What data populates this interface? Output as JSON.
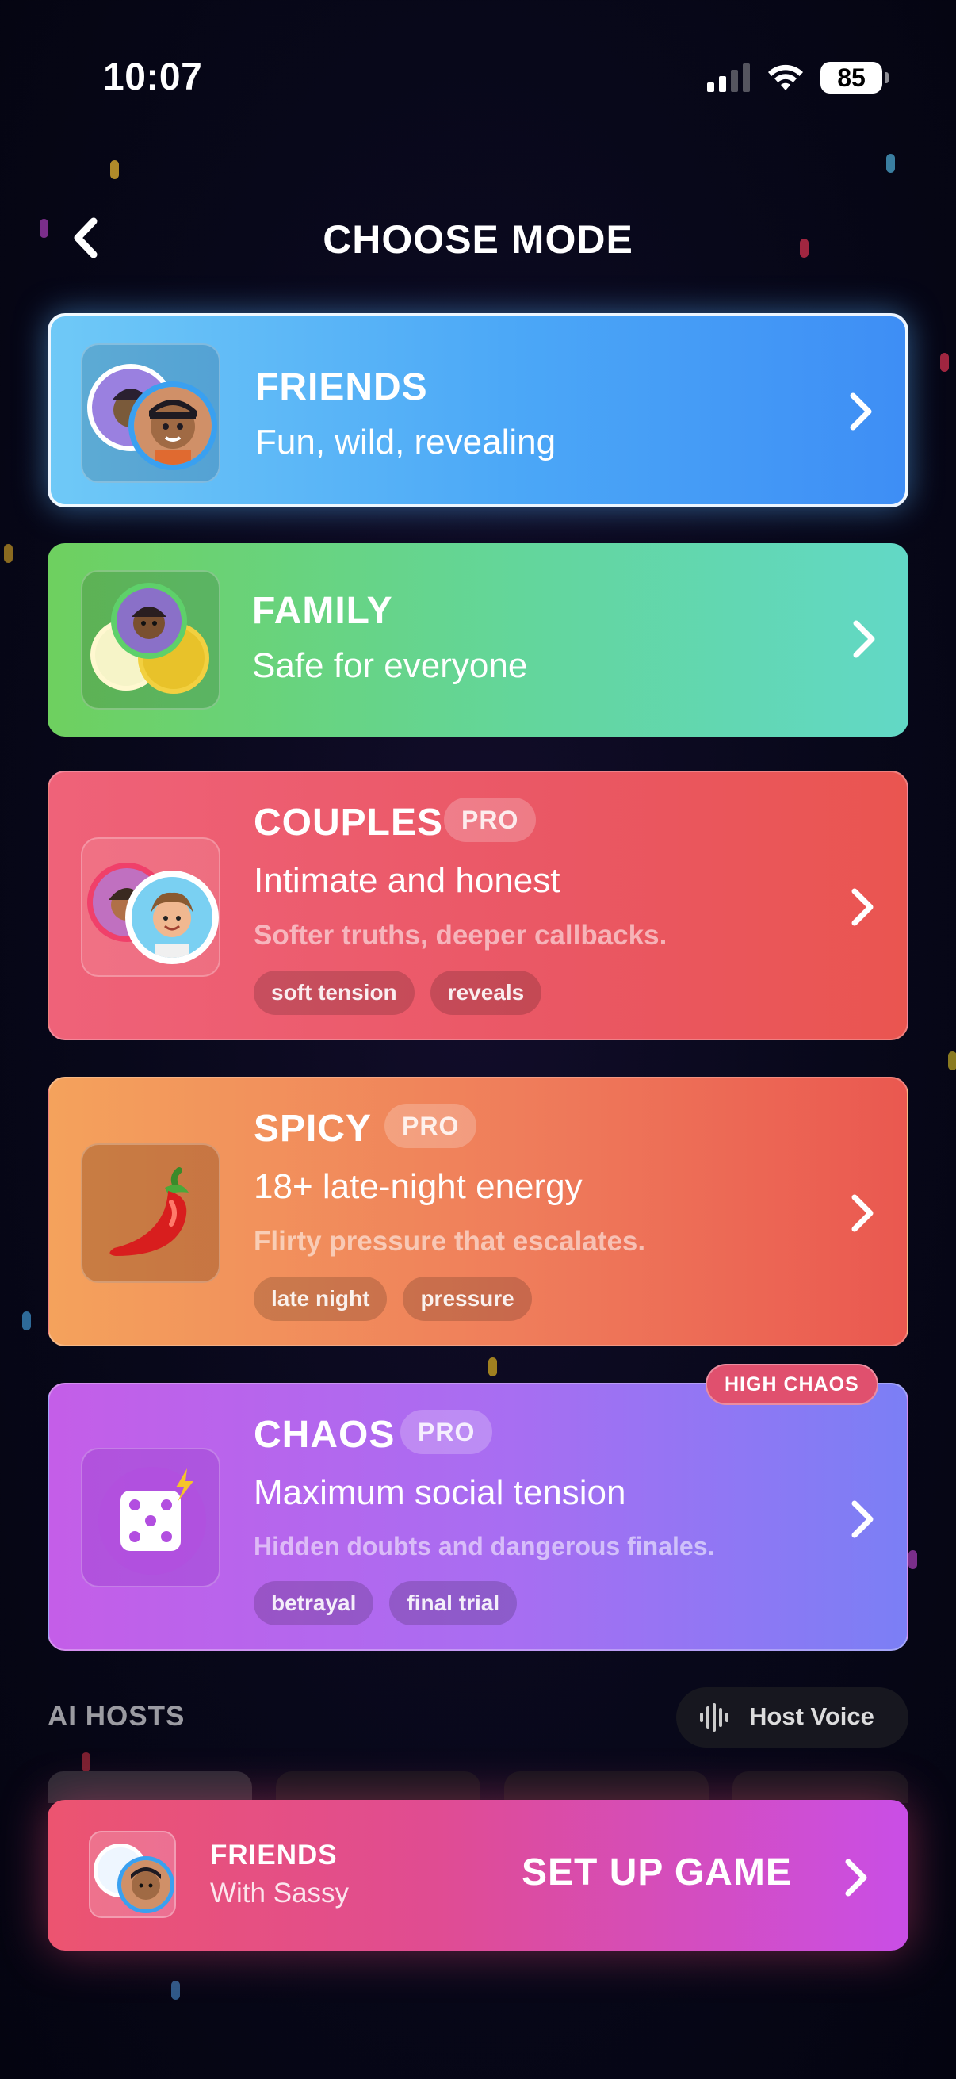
{
  "status_bar": {
    "time": "10:07",
    "battery": "85"
  },
  "header": {
    "title": "CHOOSE MODE"
  },
  "modes": [
    {
      "name": "FRIENDS",
      "subtitle": "Fun, wild, revealing",
      "selected": true
    },
    {
      "name": "FAMILY",
      "subtitle": "Safe for everyone"
    },
    {
      "name": "COUPLES",
      "badge": "PRO",
      "subtitle": "Intimate and honest",
      "description": "Softer truths, deeper callbacks.",
      "tags": [
        "soft tension",
        "reveals"
      ]
    },
    {
      "name": "SPICY",
      "badge": "PRO",
      "subtitle": "18+ late-night energy",
      "description": "Flirty pressure that escalates.",
      "tags": [
        "late night",
        "pressure"
      ],
      "icon": "chili-pepper-icon"
    },
    {
      "name": "CHAOS",
      "badge": "PRO",
      "subtitle": "Maximum social tension",
      "description": "Hidden doubts and dangerous finales.",
      "tags": [
        "betrayal",
        "final trial"
      ],
      "corner_badge": "HIGH CHAOS",
      "icon": "dice-icon"
    }
  ],
  "ai_hosts": {
    "title": "AI HOSTS",
    "voice_button": "Host Voice"
  },
  "cta": {
    "mode": "FRIENDS",
    "host": "With Sassy",
    "action": "SET UP GAME"
  },
  "colors": {
    "friends": "#4ba7f7",
    "family": "#63d69b",
    "couples": "#ea5764",
    "spicy": "#ef7d5b",
    "chaos": "#a76ef2",
    "cta": "#e04c92"
  }
}
